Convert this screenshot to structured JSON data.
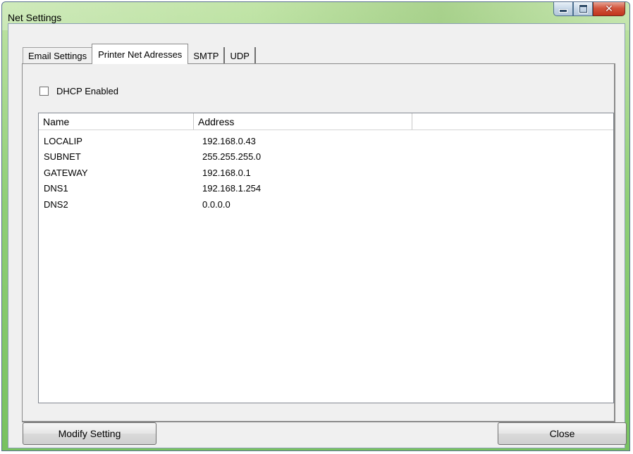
{
  "window": {
    "title": "Net Settings"
  },
  "tabs": [
    {
      "label": "Email Settings"
    },
    {
      "label": "Printer Net Adresses"
    },
    {
      "label": "SMTP"
    },
    {
      "label": "UDP"
    }
  ],
  "dhcp": {
    "label": "DHCP Enabled",
    "checked": false
  },
  "list": {
    "columns": [
      "Name",
      "Address",
      ""
    ],
    "rows": [
      {
        "name": "LOCALIP",
        "address": "192.168.0.43"
      },
      {
        "name": "SUBNET",
        "address": "255.255.255.0"
      },
      {
        "name": "GATEWAY",
        "address": "192.168.0.1"
      },
      {
        "name": "DNS1",
        "address": "192.168.1.254"
      },
      {
        "name": "DNS2",
        "address": "0.0.0.0"
      }
    ]
  },
  "buttons": {
    "modify": "Modify Setting",
    "close": "Close"
  }
}
